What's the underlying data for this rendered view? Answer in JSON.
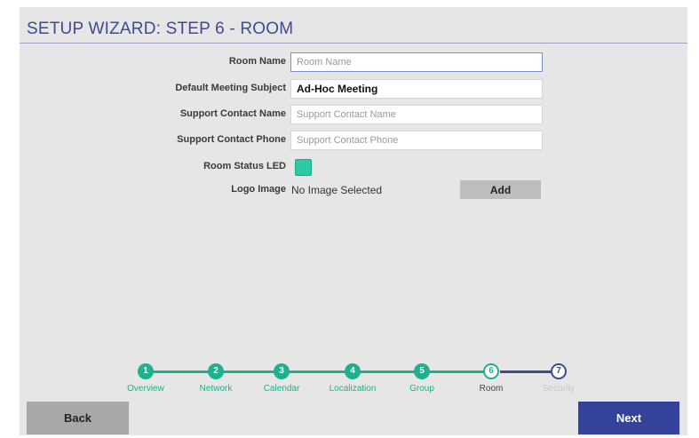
{
  "header": {
    "title": "SETUP WIZARD: STEP 6 - ROOM"
  },
  "form": {
    "room_name": {
      "label": "Room Name",
      "value": "",
      "placeholder": "Room Name"
    },
    "meeting_subject": {
      "label": "Default Meeting Subject",
      "value": "Ad-Hoc Meeting",
      "placeholder": ""
    },
    "support_name": {
      "label": "Support Contact Name",
      "value": "",
      "placeholder": "Support Contact Name"
    },
    "support_phone": {
      "label": "Support Contact Phone",
      "value": "",
      "placeholder": "Support Contact Phone"
    },
    "room_status_led": {
      "label": "Room Status LED",
      "checked": true,
      "color": "#2bc9a4"
    },
    "logo_image": {
      "label": "Logo Image",
      "value": "No Image Selected",
      "button_label": "Add"
    }
  },
  "stepper": {
    "steps": [
      {
        "number": "1",
        "label": "Overview",
        "state": "done"
      },
      {
        "number": "2",
        "label": "Network",
        "state": "done"
      },
      {
        "number": "3",
        "label": "Calendar",
        "state": "done"
      },
      {
        "number": "4",
        "label": "Localization",
        "state": "done"
      },
      {
        "number": "5",
        "label": "Group",
        "state": "done"
      },
      {
        "number": "6",
        "label": "Room",
        "state": "current"
      },
      {
        "number": "7",
        "label": "Security",
        "state": "todo"
      }
    ]
  },
  "nav": {
    "back_label": "Back",
    "next_label": "Next"
  },
  "colors": {
    "accent": "#3d4b93",
    "done": "#1fb08e",
    "next_button": "#33429a"
  }
}
